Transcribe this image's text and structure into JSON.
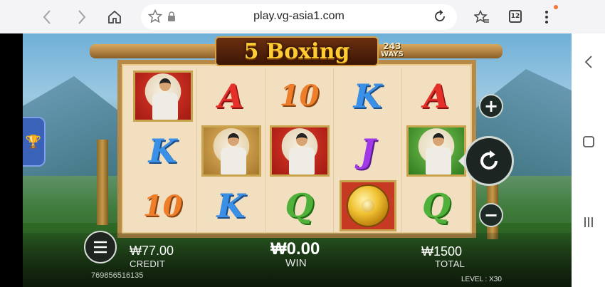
{
  "browser": {
    "url": "play.vg-asia1.com",
    "tab_count": "12"
  },
  "game": {
    "title": "5 Boxing",
    "ways_number": "243",
    "ways_label": "WAYS",
    "reels": [
      [
        "fighter-red",
        "A",
        "10",
        "K",
        "A"
      ],
      [
        "K",
        "fighter-gold",
        "fighter-red",
        "J",
        "fighter-green"
      ],
      [
        "10",
        "K",
        "Q",
        "gong",
        "Q"
      ]
    ],
    "credit_value": "₩77.00",
    "credit_label": "CREDIT",
    "win_value": "₩0.00",
    "win_label": "WIN",
    "total_value": "₩1500",
    "total_label": "TOTAL",
    "game_id": "769856516135",
    "level_text": "LEVEL : X30"
  },
  "icons": {
    "back": "arrow-left-icon",
    "forward": "arrow-right-icon",
    "home": "home-icon",
    "star": "star-icon",
    "lock": "lock-icon",
    "reload": "reload-icon",
    "bookmarks": "bookmarks-icon",
    "tabs": "tabs-icon",
    "menu": "more-vert-icon",
    "trophy": "trophy-icon",
    "plus": "plus-icon",
    "minus": "minus-icon",
    "spin": "spin-icon",
    "game_menu": "hamburger-icon"
  },
  "colors": {
    "accent_notification": "#f0763a",
    "title_gold": "#ffcc33"
  }
}
